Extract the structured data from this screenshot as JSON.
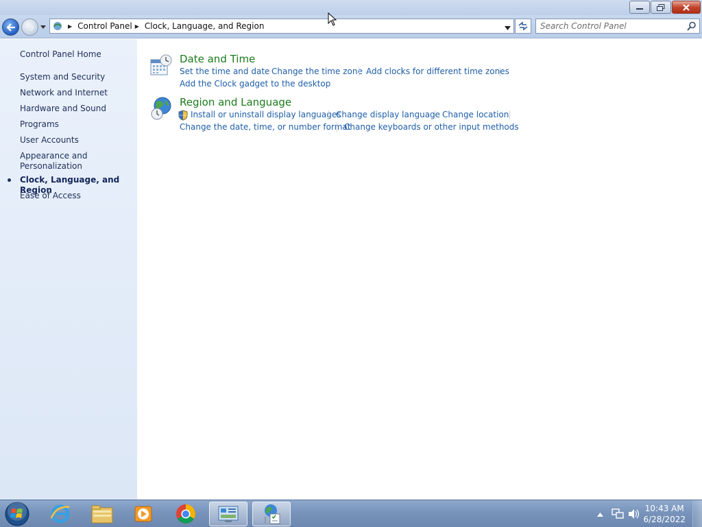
{
  "window": {
    "buttons": {
      "minimize": "minimize",
      "restore": "restore",
      "close": "close"
    }
  },
  "navigation": {
    "breadcrumb": [
      "Control Panel",
      "Clock, Language, and Region"
    ],
    "search_placeholder": "Search Control Panel"
  },
  "sidebar": {
    "home": "Control Panel Home",
    "items": [
      {
        "label": "System and Security",
        "current": false
      },
      {
        "label": "Network and Internet",
        "current": false
      },
      {
        "label": "Hardware and Sound",
        "current": false
      },
      {
        "label": "Programs",
        "current": false
      },
      {
        "label": "User Accounts",
        "current": false
      },
      {
        "label": "Appearance and Personalization",
        "current": false
      },
      {
        "label": "Clock, Language, and Region",
        "current": true
      },
      {
        "label": "Ease of Access",
        "current": false
      }
    ]
  },
  "categories": [
    {
      "title": "Date and Time",
      "icon": "calendar-clock-icon",
      "tasks": [
        "Set the time and date",
        "Change the time zone",
        "Add clocks for different time zones",
        "Add the Clock gadget to the desktop"
      ]
    },
    {
      "title": "Region and Language",
      "icon": "globe-clock-icon",
      "tasks": [
        "Install or uninstall display languages",
        "Change display language",
        "Change location",
        "Change the date, time, or number format",
        "Change keyboards or other input methods"
      ]
    }
  ],
  "taskbar": {
    "apps": [
      "start-orb-icon",
      "internet-explorer-icon",
      "file-explorer-icon",
      "media-player-icon",
      "chrome-icon",
      "control-panel-icon",
      "region-language-icon"
    ],
    "clock_time": "10:43 AM",
    "clock_date": "6/28/2022"
  },
  "colors": {
    "link": "#1e5ea8",
    "category_title": "#1b7a1b",
    "sidebar_bg": "#e3ecf8"
  }
}
